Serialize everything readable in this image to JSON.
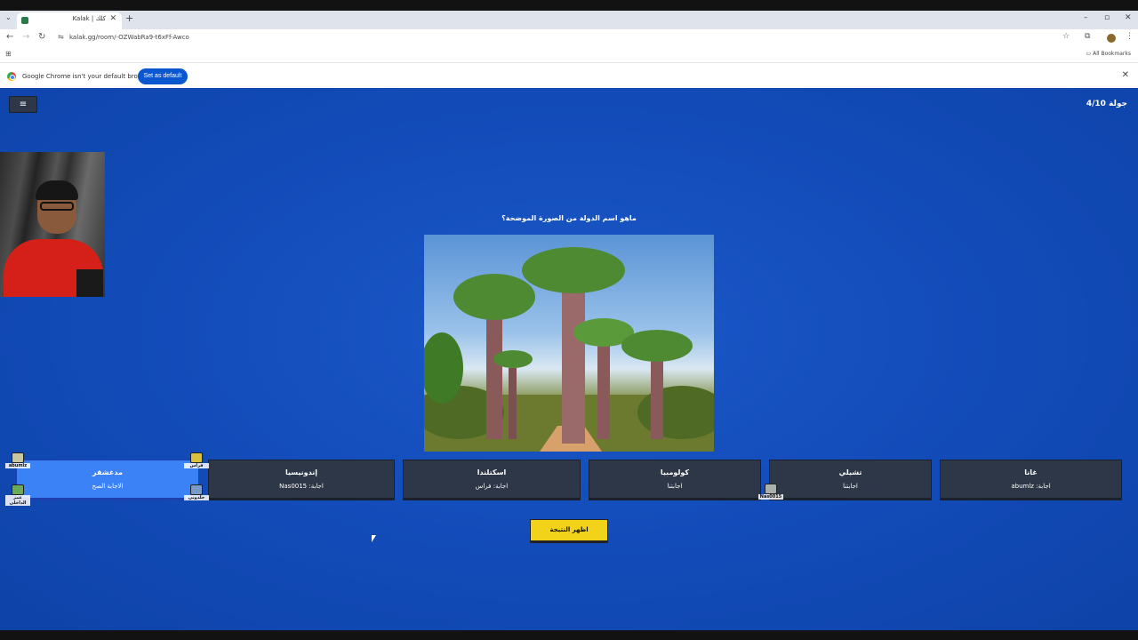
{
  "browser": {
    "tab_title": "Kalak | كلك",
    "tab_close": "✕",
    "new_tab": "+",
    "tab_menu": "⌄",
    "url": "kalak.gg/room/-OZWabRa9-t6xFf-Awco",
    "all_bookmarks": "All Bookmarks",
    "controls": {
      "minimize": "–",
      "maximize": "▫",
      "close": "✕"
    },
    "nav": {
      "back": "←",
      "forward": "→",
      "reload": "↻"
    },
    "icons": {
      "star": "☆",
      "extensions": "⧉",
      "kebab": "⋮",
      "apps": "⊞",
      "tune": "⇋",
      "bookmark_folder": "▭"
    }
  },
  "infobar": {
    "message": "Google Chrome isn't your default browser",
    "button": "Set as default",
    "close": "✕"
  },
  "game": {
    "menu_icon": "≡",
    "round": "جولة 4/10",
    "question": "ماهو اسم الدولة من الصورة الموضحة؟",
    "answers": [
      {
        "name": "مدغشقر",
        "by": "الاجابة الصح"
      },
      {
        "name": "إندونيسيا",
        "by": "اجابة: Nas0015"
      },
      {
        "name": "اسكتلندا",
        "by": "اجابة: فراس"
      },
      {
        "name": "كولومبيا",
        "by": "اجابتنا"
      },
      {
        "name": "تشيلي",
        "by": "اجابتنا"
      },
      {
        "name": "غانا",
        "by": "اجابة: abumlz"
      }
    ],
    "avatars": {
      "a1": "abumlz",
      "a2": "فراس",
      "a3": "عمر الداخلي",
      "a4": "خلدوني",
      "a5": "Nas0015"
    },
    "reveal_button": "اظهر النتيجة"
  },
  "colors": {
    "background": "#124bb8",
    "card": "#2d3748",
    "correct": "#3b82f6",
    "reveal": "#f2d31a"
  }
}
